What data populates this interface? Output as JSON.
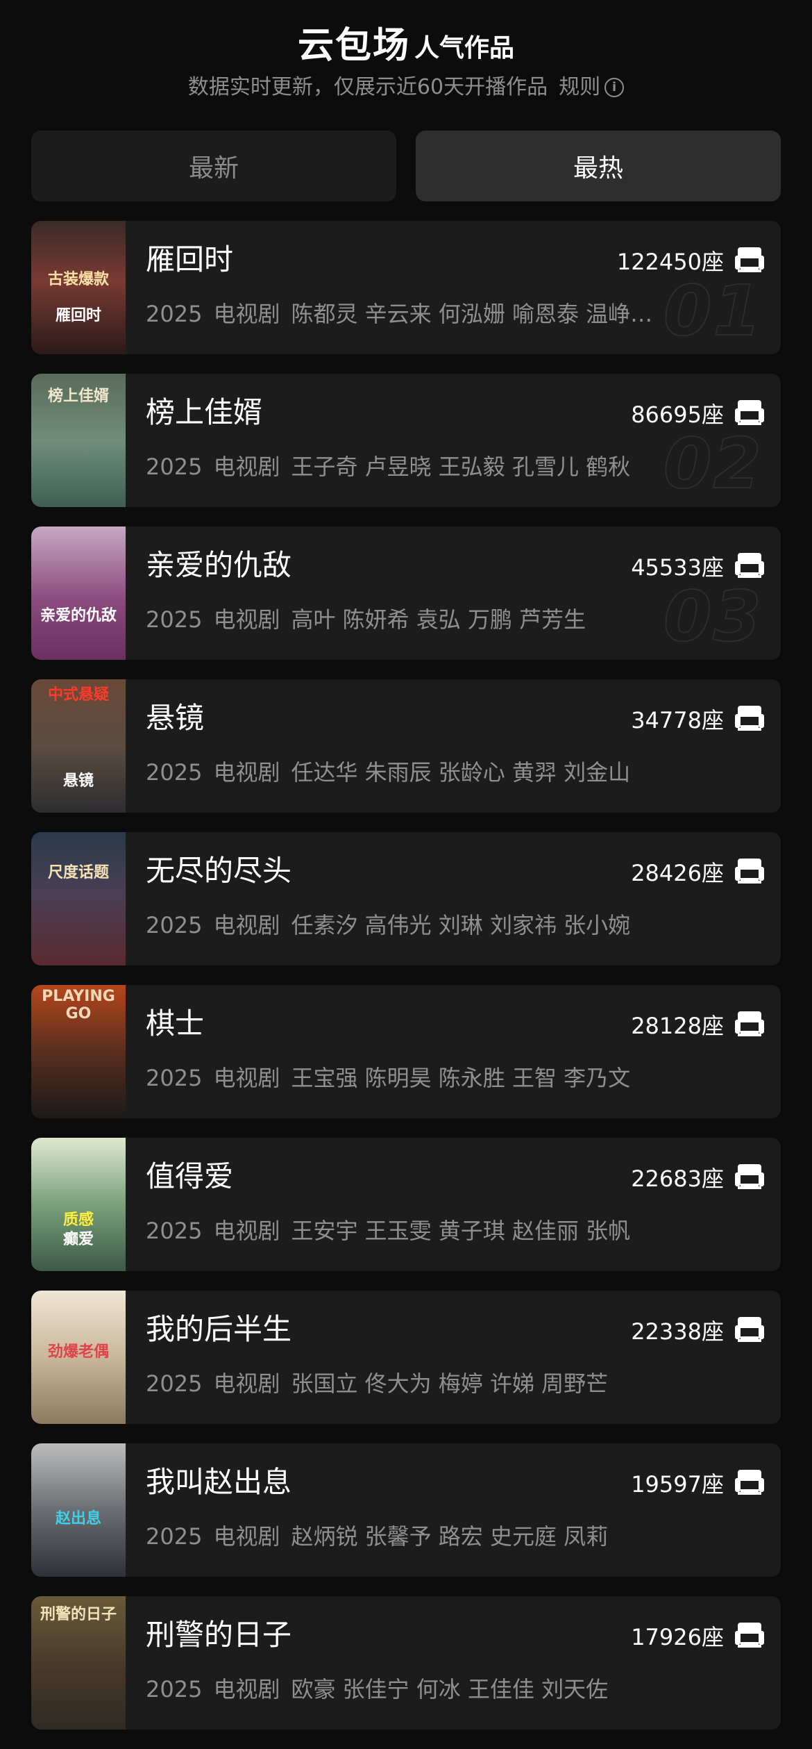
{
  "header": {
    "title_main": "云包场",
    "title_sub": "人气作品",
    "subtitle": "数据实时更新，仅展示近60天开播作品",
    "rules_label": "规则",
    "info_icon": "info-circle-icon"
  },
  "tabs": [
    {
      "label": "最新",
      "active": false
    },
    {
      "label": "最热",
      "active": true
    }
  ],
  "colors": {
    "background": "#0c0c0c",
    "card": "#1c1c1c",
    "tab_active": "#2e2e2e",
    "muted_text": "#8f8f8f"
  },
  "items": [
    {
      "title": "雁回时",
      "seats": "122450座",
      "year": "2025",
      "type": "电视剧",
      "cast": "陈都灵  辛云来  何泓姗  喻恩泰  温峥…",
      "rank": "01",
      "poster_text": "古装爆款",
      "poster_bottom": "雁回时"
    },
    {
      "title": "榜上佳婿",
      "seats": "86695座",
      "year": "2025",
      "type": "电视剧",
      "cast": "王子奇  卢昱晓  王弘毅  孔雪儿  鹤秋",
      "rank": "02",
      "poster_text": "榜上佳婿",
      "poster_bottom": ""
    },
    {
      "title": "亲爱的仇敌",
      "seats": "45533座",
      "year": "2025",
      "type": "电视剧",
      "cast": "高叶  陈妍希  袁弘  万鹏  芦芳生",
      "rank": "03",
      "poster_text": "亲爱的仇敌",
      "poster_bottom": ""
    },
    {
      "title": "悬镜",
      "seats": "34778座",
      "year": "2025",
      "type": "电视剧",
      "cast": "任达华  朱雨辰  张龄心  黄羿  刘金山",
      "rank": "",
      "poster_text": "中式悬疑",
      "poster_bottom": "悬镜"
    },
    {
      "title": "无尽的尽头",
      "seats": "28426座",
      "year": "2025",
      "type": "电视剧",
      "cast": "任素汐  高伟光  刘琳  刘家祎  张小婉",
      "rank": "",
      "poster_text": "尺度话题",
      "poster_bottom": ""
    },
    {
      "title": "棋士",
      "seats": "28128座",
      "year": "2025",
      "type": "电视剧",
      "cast": "王宝强  陈明昊  陈永胜  王智  李乃文",
      "rank": "",
      "poster_text": "PLAYING GO",
      "poster_bottom": ""
    },
    {
      "title": "值得爱",
      "seats": "22683座",
      "year": "2025",
      "type": "电视剧",
      "cast": "王安宇  王玉雯  黄子琪  赵佳丽  张帆",
      "rank": "",
      "poster_text": "质感",
      "poster_bottom": "癫爱"
    },
    {
      "title": "我的后半生",
      "seats": "22338座",
      "year": "2025",
      "type": "电视剧",
      "cast": "张国立  佟大为  梅婷  许娣  周野芒",
      "rank": "",
      "poster_text": "劲爆老偶",
      "poster_bottom": ""
    },
    {
      "title": "我叫赵出息",
      "seats": "19597座",
      "year": "2025",
      "type": "电视剧",
      "cast": "赵炳锐  张馨予  路宏  史元庭  凤莉",
      "rank": "",
      "poster_text": "赵出息",
      "poster_bottom": ""
    },
    {
      "title": "刑警的日子",
      "seats": "17926座",
      "year": "2025",
      "type": "电视剧",
      "cast": "欧豪  张佳宁  何冰  王佳佳  刘天佐",
      "rank": "",
      "poster_text": "刑警的日子",
      "poster_bottom": ""
    }
  ]
}
